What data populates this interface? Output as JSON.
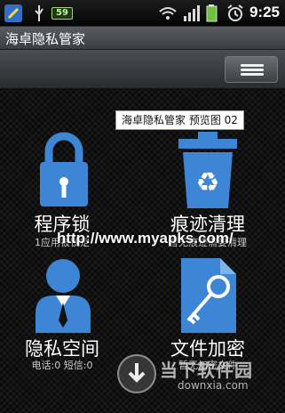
{
  "statusbar": {
    "battery_badge": "59",
    "time": "9:25",
    "icons": [
      "app-icon",
      "usb-icon",
      "battery-indicator",
      "wifi-icon",
      "signal-icon",
      "battery-icon",
      "alarm-icon"
    ]
  },
  "app": {
    "title": "海卓隐私管家"
  },
  "toolbar": {
    "menu_icon": "menu-icon"
  },
  "tooltip": "海卓隐私管家 预览图 02",
  "tiles": [
    {
      "label": "程序锁",
      "sub": "1应用被锁定",
      "icon": "lock-icon"
    },
    {
      "label": "痕迹清理",
      "sub": "暂无痕迹需要清理",
      "icon": "recycle-bin-icon"
    },
    {
      "label": "隐私空间",
      "sub": "电话:0 短信:0",
      "icon": "person-icon"
    },
    {
      "label": "文件加密",
      "sub": "暂无加密文件",
      "icon": "key-file-icon"
    }
  ],
  "watermarks": {
    "url": "http://www.myapks.com/",
    "brand": "当下软件园",
    "brand_url": "downxia.com"
  },
  "colors": {
    "icon_blue": "#3d86d6",
    "background": "#0a0a0a"
  }
}
